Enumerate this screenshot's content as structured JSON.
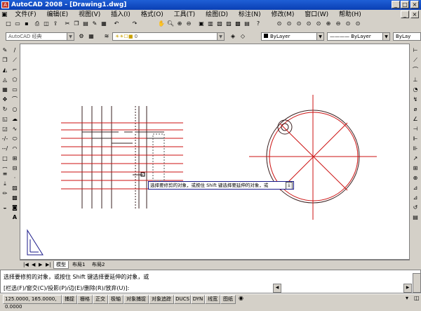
{
  "window": {
    "title": "AutoCAD 2008 - [Drawing1.dwg]"
  },
  "menu": [
    "文件(F)",
    "编辑(E)",
    "视图(V)",
    "插入(I)",
    "格式(O)",
    "工具(T)",
    "绘图(D)",
    "标注(N)",
    "修改(M)",
    "窗口(W)",
    "帮助(H)"
  ],
  "toolbar2": {
    "workspace": "AutoCAD 经典",
    "layer": "0",
    "color": "ByLayer",
    "linetype": "ByLayer",
    "lineweight": "ByLay"
  },
  "tabs": [
    "模型",
    "布局1",
    "布局2"
  ],
  "tooltip": "选择要修剪的对象，或按住 Shift 键选择要延伸的对象，或",
  "command": {
    "line1": "选择要修剪的对象，或按住 Shift 键选择要延伸的对象，或",
    "line2": "[栏选(F)/窗交(C)/投影(P)/边(E)/删除(R)/放弃(U)]:"
  },
  "status": {
    "coords": "125.0000, 165.0000, 0.0000",
    "buttons": [
      "捕捉",
      "栅格",
      "正交",
      "极轴",
      "对象捕捉",
      "对象追踪",
      "DUCS",
      "DYN",
      "线宽",
      "图纸"
    ]
  },
  "colors": {
    "title": "#0a3fb4",
    "drawRed": "#cc1111",
    "drawDark": "#3a2020"
  }
}
